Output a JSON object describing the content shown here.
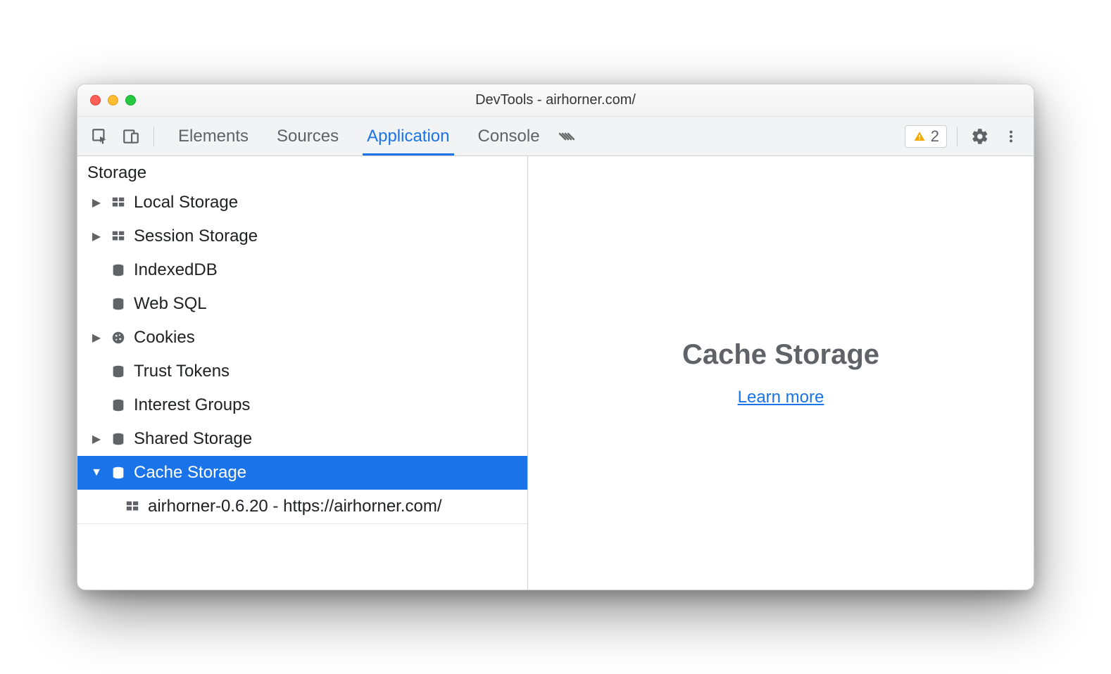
{
  "window": {
    "title": "DevTools - airhorner.com/"
  },
  "tabs": {
    "items": [
      "Elements",
      "Sources",
      "Application",
      "Console"
    ],
    "active_index": 2,
    "warning_count": "2"
  },
  "sidebar": {
    "section": "Storage",
    "items": [
      {
        "label": "Local Storage",
        "icon": "grid",
        "expander": "right"
      },
      {
        "label": "Session Storage",
        "icon": "grid",
        "expander": "right"
      },
      {
        "label": "IndexedDB",
        "icon": "db",
        "expander": "none"
      },
      {
        "label": "Web SQL",
        "icon": "db",
        "expander": "none"
      },
      {
        "label": "Cookies",
        "icon": "cookie",
        "expander": "right"
      },
      {
        "label": "Trust Tokens",
        "icon": "db",
        "expander": "none"
      },
      {
        "label": "Interest Groups",
        "icon": "db",
        "expander": "none"
      },
      {
        "label": "Shared Storage",
        "icon": "db",
        "expander": "right"
      },
      {
        "label": "Cache Storage",
        "icon": "db",
        "expander": "down",
        "selected": true
      }
    ],
    "cache_child": "airhorner-0.6.20 - https://airhorner.com/"
  },
  "main": {
    "heading": "Cache Storage",
    "link": "Learn more"
  }
}
